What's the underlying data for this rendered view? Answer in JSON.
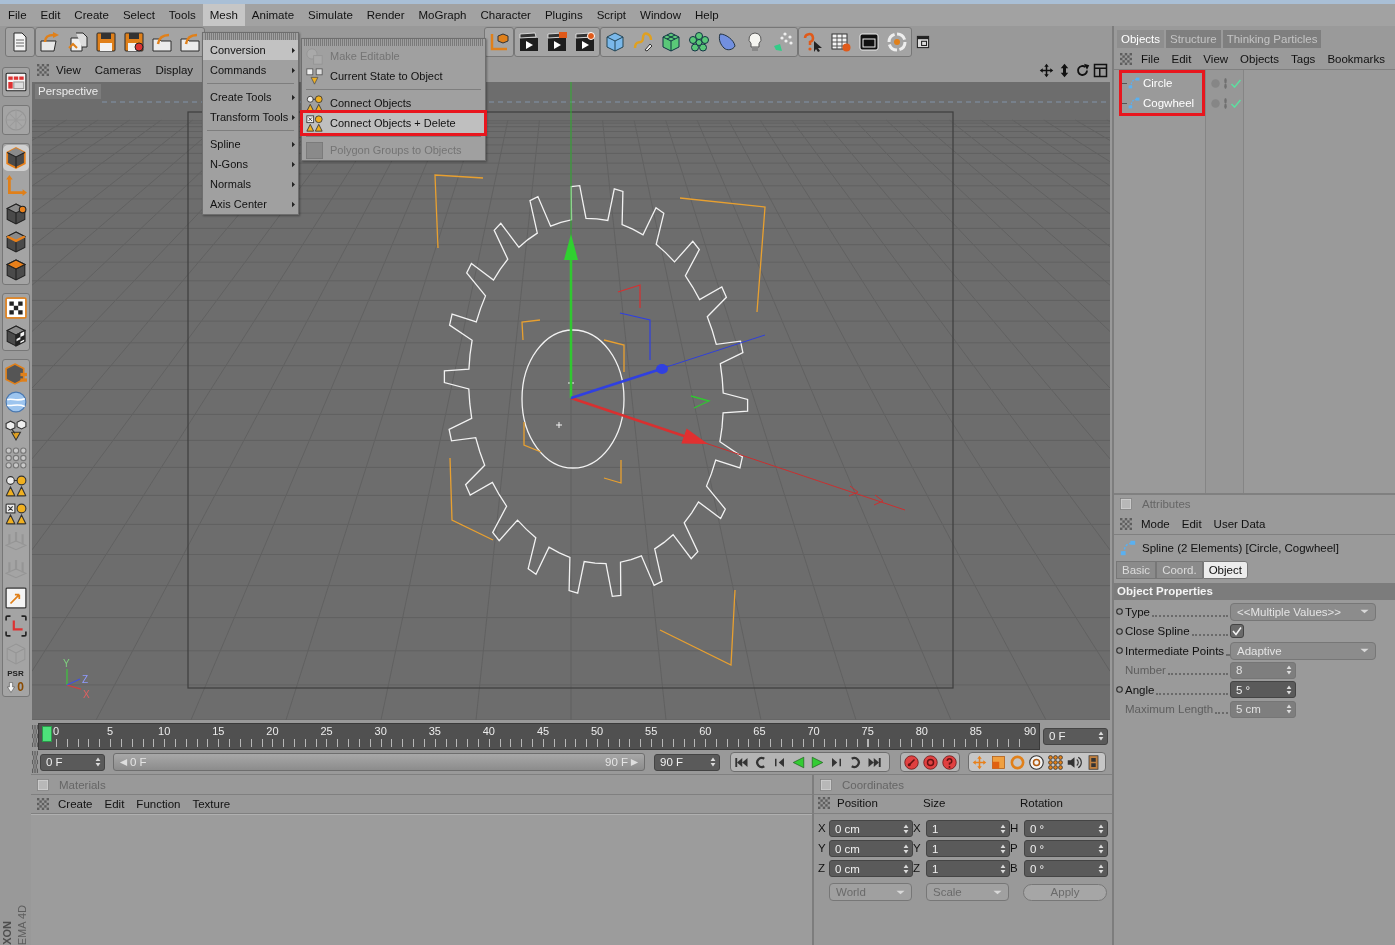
{
  "menubar": {
    "items": [
      {
        "label": "File",
        "selected": false
      },
      {
        "label": "Edit",
        "selected": false
      },
      {
        "label": "Create",
        "selected": false
      },
      {
        "label": "Select",
        "selected": false
      },
      {
        "label": "Tools",
        "selected": false
      },
      {
        "label": "Mesh",
        "selected": true
      },
      {
        "label": "Animate",
        "selected": false
      },
      {
        "label": "Simulate",
        "selected": false
      },
      {
        "label": "Render",
        "selected": false
      },
      {
        "label": "MoGraph",
        "selected": false
      },
      {
        "label": "Character",
        "selected": false
      },
      {
        "label": "Plugins",
        "selected": false
      },
      {
        "label": "Script",
        "selected": false
      },
      {
        "label": "Window",
        "selected": false
      },
      {
        "label": "Help",
        "selected": false
      }
    ]
  },
  "mesh_menu": {
    "items": [
      {
        "label": "Conversion",
        "selected": true,
        "separator_before": false
      },
      {
        "label": "Commands",
        "selected": false,
        "separator_before": false
      },
      {
        "label": "Create Tools",
        "selected": false,
        "separator_before": true
      },
      {
        "label": "Transform Tools",
        "selected": false,
        "separator_before": false
      },
      {
        "label": "Spline",
        "selected": false,
        "separator_before": true
      },
      {
        "label": "N-Gons",
        "selected": false,
        "separator_before": false
      },
      {
        "label": "Normals",
        "selected": false,
        "separator_before": false
      },
      {
        "label": "Axis Center",
        "selected": false,
        "separator_before": false
      }
    ]
  },
  "conversion_submenu": {
    "items": [
      {
        "label": "Make Editable",
        "disabled": true,
        "selected": false,
        "annotated": false,
        "separator_before": false
      },
      {
        "label": "Current State to Object",
        "disabled": false,
        "selected": false,
        "annotated": false,
        "separator_before": false
      },
      {
        "label": "Connect Objects",
        "disabled": false,
        "selected": false,
        "annotated": false,
        "separator_before": true
      },
      {
        "label": "Connect Objects + Delete",
        "disabled": false,
        "selected": true,
        "annotated": true,
        "separator_before": false
      },
      {
        "label": "Polygon Groups to Objects",
        "disabled": true,
        "selected": false,
        "annotated": false,
        "separator_before": true
      }
    ]
  },
  "left_toolbar": {
    "modes": [
      {
        "selected": true
      },
      {
        "selected": false
      },
      {
        "selected": false
      },
      {
        "selected": false
      },
      {
        "selected": false
      }
    ],
    "psr_label": "PSR",
    "psr_value": "0"
  },
  "logo": [
    "XON",
    "EMA 4D"
  ],
  "viewport": {
    "menu": [
      "View",
      "Cameras",
      "Display"
    ],
    "camera": "Perspective",
    "axis_labels": [
      "Y",
      "Z",
      "X"
    ]
  },
  "object_manager": {
    "tabs": [
      {
        "label": "Objects",
        "selected": true
      },
      {
        "label": "Structure",
        "selected": false
      },
      {
        "label": "Thinking Particles",
        "selected": false
      }
    ],
    "menu": [
      "File",
      "Edit",
      "View",
      "Objects",
      "Tags",
      "Bookmarks"
    ],
    "annotated": true,
    "objects": [
      {
        "name": "Circle",
        "enabled": true
      },
      {
        "name": "Cogwheel",
        "enabled": true
      }
    ]
  },
  "attributes": {
    "title": "Attributes",
    "menu": [
      "Mode",
      "Edit",
      "User Data"
    ],
    "object_title": "Spline (2 Elements) [Circle, Cogwheel]",
    "tabs": [
      {
        "label": "Basic",
        "selected": false
      },
      {
        "label": "Coord.",
        "selected": false
      },
      {
        "label": "Object",
        "selected": true
      }
    ],
    "section": "Object Properties",
    "properties": [
      {
        "label": "Type",
        "kind": "dropdown",
        "value": "<<Multiple Values>>",
        "disabled": false
      },
      {
        "label": "Close Spline",
        "kind": "checkbox",
        "checked": true,
        "disabled": false
      },
      {
        "label": "Intermediate Points",
        "kind": "dropdown",
        "value": "Adaptive",
        "disabled": false
      },
      {
        "label": "Number",
        "kind": "number",
        "value": "8",
        "disabled": true
      },
      {
        "label": "Angle",
        "kind": "number",
        "value": "5 °",
        "disabled": false
      },
      {
        "label": "Maximum Length",
        "kind": "number",
        "value": "5 cm",
        "disabled": true
      }
    ]
  },
  "timeline": {
    "ticks": [
      "0",
      "5",
      "10",
      "15",
      "20",
      "25",
      "30",
      "35",
      "40",
      "45",
      "50",
      "55",
      "60",
      "65",
      "70",
      "75",
      "80",
      "85",
      "90"
    ],
    "level": 0,
    "current_frame": "0 F"
  },
  "playback": {
    "start": "0 F",
    "range_start": "0 F",
    "range_end": "90 F",
    "end": "90 F"
  },
  "materials": {
    "title": "Materials",
    "menu": [
      "Create",
      "Edit",
      "Function",
      "Texture"
    ]
  },
  "coordinates": {
    "title": "Coordinates",
    "columns": [
      "Position",
      "Size",
      "Rotation"
    ],
    "rows": [
      [
        {
          "axis": "X",
          "value": "0 cm"
        },
        {
          "axis": "X",
          "value": "1"
        },
        {
          "axis": "H",
          "value": "0 °"
        }
      ],
      [
        {
          "axis": "Y",
          "value": "0 cm"
        },
        {
          "axis": "Y",
          "value": "1"
        },
        {
          "axis": "P",
          "value": "0 °"
        }
      ],
      [
        {
          "axis": "Z",
          "value": "0 cm"
        },
        {
          "axis": "Z",
          "value": "1"
        },
        {
          "axis": "B",
          "value": "0 °"
        }
      ]
    ],
    "dropdowns": [
      {
        "value": "World",
        "disabled": true
      },
      {
        "value": "Scale",
        "disabled": true
      }
    ],
    "apply": {
      "label": "Apply",
      "disabled": true
    }
  }
}
